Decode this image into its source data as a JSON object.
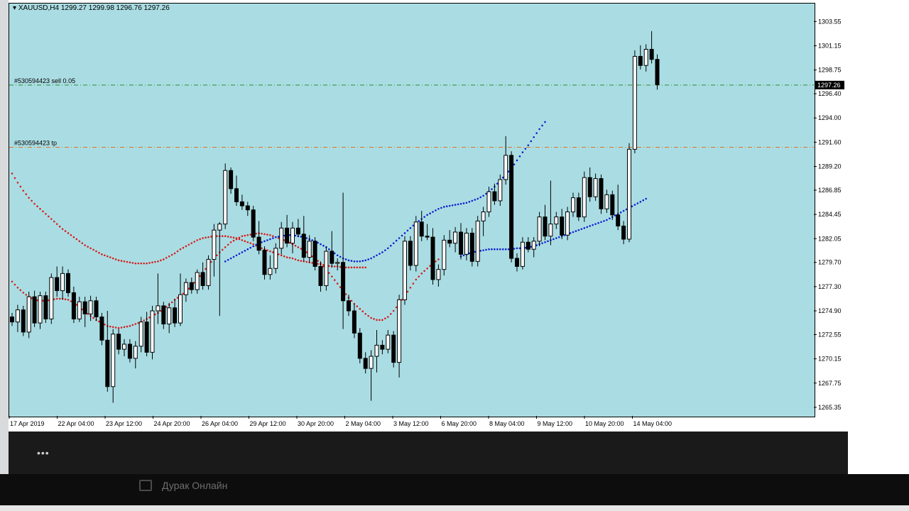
{
  "window": {
    "title": "XAUUSD,H4  1299.27 1299.98 1296.76 1297.26",
    "symbol": "XAUUSD",
    "timeframe": "H4"
  },
  "orders": [
    {
      "label": "#530594423 sell 0.05",
      "price": 1297.26,
      "color": "#2e8b2e"
    },
    {
      "label": "#530594423 tp",
      "price": 1291.1,
      "color": "#e07020"
    }
  ],
  "current_price_label": "1297.26",
  "taskbar": {
    "app_label": "Дурак Онлайн"
  },
  "colors": {
    "background": "#aadde3",
    "bull": "#ffffff",
    "bear": "#000000",
    "fast_ma": "#d42020",
    "slow_ma": "#1020d0"
  },
  "chart_data": {
    "type": "candlestick",
    "title": "XAUUSD,H4",
    "ylim": [
      1264.5,
      1305.4
    ],
    "y_ticks": [
      "1303.55",
      "1301.15",
      "1298.75",
      "1296.40",
      "1294.00",
      "1291.60",
      "1289.20",
      "1286.85",
      "1284.45",
      "1282.05",
      "1279.70",
      "1277.30",
      "1274.90",
      "1272.55",
      "1270.15",
      "1267.75",
      "1265.35"
    ],
    "x_ticks": [
      "17 Apr 2019",
      "22 Apr 04:00",
      "23 Apr 12:00",
      "24 Apr 20:00",
      "26 Apr 04:00",
      "29 Apr 12:00",
      "30 Apr 20:00",
      "2 May 04:00",
      "3 May 12:00",
      "6 May 20:00",
      "8 May 04:00",
      "9 May 12:00",
      "10 May 20:00",
      "14 May 04:00"
    ],
    "candles": [
      [
        1274.3,
        1274.7,
        1273.4,
        1273.8
      ],
      [
        1273.8,
        1275.5,
        1272.8,
        1275.0
      ],
      [
        1275.0,
        1275.4,
        1272.4,
        1272.8
      ],
      [
        1272.8,
        1276.8,
        1272.2,
        1276.3
      ],
      [
        1276.3,
        1276.9,
        1273.3,
        1273.7
      ],
      [
        1273.7,
        1276.8,
        1273.1,
        1276.4
      ],
      [
        1276.4,
        1276.8,
        1273.7,
        1274.1
      ],
      [
        1274.1,
        1278.6,
        1273.6,
        1278.2
      ],
      [
        1278.2,
        1279.3,
        1276.3,
        1276.9
      ],
      [
        1276.9,
        1279.3,
        1276.0,
        1278.6
      ],
      [
        1278.6,
        1279.0,
        1276.3,
        1276.7
      ],
      [
        1276.7,
        1277.3,
        1273.7,
        1274.1
      ],
      [
        1274.1,
        1276.3,
        1273.8,
        1275.8
      ],
      [
        1275.8,
        1276.3,
        1273.3,
        1274.6
      ],
      [
        1274.6,
        1276.4,
        1273.9,
        1275.9
      ],
      [
        1275.9,
        1276.3,
        1273.9,
        1274.3
      ],
      [
        1274.3,
        1274.7,
        1271.5,
        1272.0
      ],
      [
        1272.0,
        1274.9,
        1266.9,
        1267.4
      ],
      [
        1267.4,
        1273.1,
        1265.8,
        1272.6
      ],
      [
        1272.6,
        1273.1,
        1270.6,
        1271.1
      ],
      [
        1271.1,
        1272.1,
        1270.4,
        1271.6
      ],
      [
        1271.6,
        1272.1,
        1269.8,
        1270.2
      ],
      [
        1270.2,
        1271.9,
        1269.2,
        1271.4
      ],
      [
        1271.4,
        1274.3,
        1270.8,
        1273.8
      ],
      [
        1273.8,
        1274.8,
        1270.4,
        1270.8
      ],
      [
        1270.8,
        1275.4,
        1270.1,
        1274.9
      ],
      [
        1274.9,
        1278.6,
        1273.6,
        1275.4
      ],
      [
        1275.4,
        1275.8,
        1273.1,
        1273.6
      ],
      [
        1273.6,
        1275.7,
        1272.7,
        1275.2
      ],
      [
        1275.2,
        1276.1,
        1273.3,
        1273.7
      ],
      [
        1273.7,
        1278.6,
        1273.4,
        1276.5
      ],
      [
        1276.5,
        1278.1,
        1275.8,
        1277.7
      ],
      [
        1277.7,
        1278.2,
        1276.6,
        1277.0
      ],
      [
        1277.0,
        1279.0,
        1276.6,
        1278.7
      ],
      [
        1278.7,
        1279.7,
        1277.0,
        1277.4
      ],
      [
        1277.4,
        1280.4,
        1277.0,
        1280.0
      ],
      [
        1280.0,
        1283.5,
        1278.3,
        1282.9
      ],
      [
        1282.9,
        1283.7,
        1274.4,
        1283.5
      ],
      [
        1283.5,
        1289.5,
        1283.0,
        1288.8
      ],
      [
        1288.8,
        1289.1,
        1286.5,
        1287.0
      ],
      [
        1287.0,
        1288.3,
        1285.3,
        1285.7
      ],
      [
        1285.7,
        1286.4,
        1284.9,
        1285.3
      ],
      [
        1285.3,
        1285.7,
        1284.3,
        1284.9
      ],
      [
        1284.9,
        1285.3,
        1281.8,
        1282.2
      ],
      [
        1282.2,
        1283.8,
        1280.5,
        1280.9
      ],
      [
        1280.9,
        1281.3,
        1278.0,
        1278.5
      ],
      [
        1278.5,
        1280.4,
        1278.0,
        1279.1
      ],
      [
        1279.1,
        1281.6,
        1278.6,
        1281.1
      ],
      [
        1281.1,
        1283.7,
        1280.5,
        1283.1
      ],
      [
        1283.1,
        1284.4,
        1281.2,
        1281.6
      ],
      [
        1281.6,
        1283.7,
        1280.6,
        1283.1
      ],
      [
        1283.1,
        1284.0,
        1282.2,
        1282.5
      ],
      [
        1282.5,
        1284.3,
        1279.8,
        1280.2
      ],
      [
        1280.2,
        1282.4,
        1279.7,
        1281.8
      ],
      [
        1281.8,
        1282.2,
        1278.9,
        1279.3
      ],
      [
        1279.3,
        1279.8,
        1276.8,
        1277.4
      ],
      [
        1277.4,
        1281.3,
        1276.9,
        1280.8
      ],
      [
        1280.8,
        1282.8,
        1279.2,
        1279.6
      ],
      [
        1279.6,
        1280.1,
        1278.9,
        1279.7
      ],
      [
        1279.7,
        1286.6,
        1273.1,
        1275.9
      ],
      [
        1275.9,
        1276.5,
        1274.4,
        1274.9
      ],
      [
        1274.9,
        1275.6,
        1272.2,
        1272.7
      ],
      [
        1272.7,
        1273.2,
        1269.7,
        1270.2
      ],
      [
        1270.2,
        1270.8,
        1268.7,
        1269.2
      ],
      [
        1269.2,
        1271.0,
        1266.0,
        1270.4
      ],
      [
        1270.4,
        1273.0,
        1268.8,
        1271.5
      ],
      [
        1271.5,
        1272.0,
        1270.6,
        1271.1
      ],
      [
        1271.1,
        1273.0,
        1270.7,
        1272.5
      ],
      [
        1272.5,
        1272.9,
        1269.3,
        1269.8
      ],
      [
        1269.8,
        1276.5,
        1268.3,
        1276.0
      ],
      [
        1276.0,
        1282.3,
        1275.5,
        1281.8
      ],
      [
        1281.8,
        1282.3,
        1278.9,
        1279.4
      ],
      [
        1279.4,
        1284.3,
        1278.8,
        1283.7
      ],
      [
        1283.7,
        1284.8,
        1281.8,
        1282.3
      ],
      [
        1282.3,
        1283.5,
        1281.9,
        1282.2
      ],
      [
        1282.2,
        1283.1,
        1277.5,
        1278.0
      ],
      [
        1278.0,
        1279.5,
        1277.3,
        1279.0
      ],
      [
        1279.0,
        1282.4,
        1278.4,
        1281.9
      ],
      [
        1281.9,
        1282.9,
        1281.2,
        1281.6
      ],
      [
        1281.6,
        1283.2,
        1280.7,
        1282.7
      ],
      [
        1282.7,
        1283.6,
        1280.0,
        1280.5
      ],
      [
        1280.5,
        1283.1,
        1279.9,
        1282.6
      ],
      [
        1282.6,
        1283.1,
        1279.3,
        1279.8
      ],
      [
        1279.8,
        1284.3,
        1279.3,
        1283.8
      ],
      [
        1283.8,
        1285.2,
        1282.3,
        1284.7
      ],
      [
        1284.7,
        1287.2,
        1284.2,
        1286.7
      ],
      [
        1286.7,
        1287.5,
        1285.4,
        1285.8
      ],
      [
        1285.8,
        1288.4,
        1285.3,
        1287.9
      ],
      [
        1287.9,
        1292.2,
        1287.4,
        1290.3
      ],
      [
        1290.3,
        1290.7,
        1279.7,
        1280.1
      ],
      [
        1280.1,
        1280.6,
        1278.8,
        1279.3
      ],
      [
        1279.3,
        1282.2,
        1279.0,
        1281.7
      ],
      [
        1281.7,
        1282.2,
        1280.7,
        1281.0
      ],
      [
        1281.0,
        1282.2,
        1280.2,
        1281.8
      ],
      [
        1281.8,
        1284.7,
        1281.3,
        1284.2
      ],
      [
        1284.2,
        1285.4,
        1281.9,
        1282.3
      ],
      [
        1282.3,
        1287.8,
        1281.4,
        1283.5
      ],
      [
        1283.5,
        1284.7,
        1283.0,
        1284.2
      ],
      [
        1284.2,
        1285.0,
        1282.0,
        1282.4
      ],
      [
        1282.4,
        1285.2,
        1281.9,
        1284.7
      ],
      [
        1284.7,
        1286.6,
        1284.2,
        1286.1
      ],
      [
        1286.1,
        1286.6,
        1283.8,
        1284.2
      ],
      [
        1284.2,
        1288.7,
        1283.7,
        1288.1
      ],
      [
        1288.1,
        1289.1,
        1285.7,
        1286.2
      ],
      [
        1286.2,
        1288.5,
        1285.8,
        1288.0
      ],
      [
        1288.0,
        1288.4,
        1284.5,
        1285.0
      ],
      [
        1285.0,
        1286.9,
        1284.6,
        1286.4
      ],
      [
        1286.4,
        1286.8,
        1283.9,
        1284.4
      ],
      [
        1284.4,
        1287.4,
        1282.9,
        1283.3
      ],
      [
        1283.3,
        1283.8,
        1281.5,
        1282.0
      ],
      [
        1282.0,
        1291.5,
        1281.7,
        1290.9
      ],
      [
        1290.9,
        1300.7,
        1290.5,
        1300.1
      ],
      [
        1300.1,
        1301.2,
        1298.8,
        1299.2
      ],
      [
        1299.2,
        1301.3,
        1298.6,
        1300.8
      ],
      [
        1300.8,
        1302.6,
        1299.4,
        1299.8
      ],
      [
        1299.8,
        1300.3,
        1296.8,
        1297.3
      ]
    ],
    "indicators": [
      {
        "name": "",
        "color": "#d42020",
        "values": [
          1277.8,
          1277.2,
          1276.7,
          1276.3,
          1276.0,
          1275.9,
          1275.9,
          1276.0,
          1276.1,
          1276.1,
          1276.0,
          1275.7,
          1275.3,
          1274.8,
          1274.4,
          1274.0,
          1273.7,
          1273.4,
          1273.3,
          1273.2,
          1273.3,
          1273.4,
          1273.6,
          1273.8,
          1274.1,
          1274.4,
          1274.7,
          1275.1,
          1275.5,
          1276.0,
          1276.4,
          1276.8,
          1277.4,
          1278.0,
          1278.7,
          1279.4,
          1280.1,
          1280.7,
          1281.2,
          1281.7,
          1282.0,
          1282.3,
          1282.4,
          1282.5,
          1282.6,
          1282.5,
          1282.4,
          1282.2,
          1282.0,
          1281.8,
          1281.5,
          1281.2,
          1280.9,
          1280.5,
          1280.1,
          1279.6,
          1279.0,
          1278.3,
          1277.6,
          1276.9,
          1276.2,
          1275.6,
          1275.1,
          1274.6,
          1274.2,
          1274.0,
          1274.0,
          1274.3,
          1274.9,
          1275.6,
          1276.4,
          1277.2,
          1278.0,
          1278.6,
          1279.1,
          1279.6,
          1280.0
        ]
      },
      {
        "name": "",
        "color": "#d42020",
        "values": [
          1288.5,
          1287.6,
          1286.8,
          1286.1,
          1285.5,
          1285.0,
          1284.5,
          1284.0,
          1283.5,
          1283.0,
          1282.6,
          1282.2,
          1281.8,
          1281.4,
          1281.1,
          1280.8,
          1280.5,
          1280.3,
          1280.1,
          1279.9,
          1279.8,
          1279.7,
          1279.6,
          1279.6,
          1279.6,
          1279.7,
          1279.8,
          1280.0,
          1280.3,
          1280.6,
          1281.0,
          1281.3,
          1281.6,
          1281.9,
          1282.1,
          1282.2,
          1282.3,
          1282.3,
          1282.3,
          1282.2,
          1282.1,
          1281.9,
          1281.7,
          1281.5,
          1281.2,
          1281.0,
          1280.8,
          1280.6,
          1280.4,
          1280.2,
          1280.1,
          1279.9,
          1279.8,
          1279.7,
          1279.6,
          1279.5,
          1279.4,
          1279.3,
          1279.3,
          1279.2,
          1279.2,
          1279.2,
          1279.2,
          1279.2
        ]
      },
      {
        "name": "",
        "color": "#1020d0",
        "values": [
          1279.8,
          1280.1,
          1280.4,
          1280.7,
          1281.0,
          1281.3,
          1281.6,
          1281.8,
          1282.0,
          1282.2,
          1282.3,
          1282.4,
          1282.4,
          1282.3,
          1282.2,
          1282.0,
          1281.8,
          1281.5,
          1281.2,
          1280.8,
          1280.4,
          1280.1,
          1279.9,
          1279.8,
          1279.8,
          1279.9,
          1280.1,
          1280.4,
          1280.7,
          1281.1,
          1281.6,
          1282.1,
          1282.6,
          1283.1,
          1283.6,
          1284.0,
          1284.4,
          1284.7,
          1285.0,
          1285.2,
          1285.3,
          1285.4,
          1285.5,
          1285.6,
          1285.8,
          1286.0,
          1286.3,
          1286.7,
          1287.2,
          1287.8,
          1288.4,
          1289.0,
          1289.8,
          1290.6,
          1291.3,
          1292.1,
          1292.9,
          1293.6
        ]
      },
      {
        "name": "",
        "color": "#1020d0",
        "values": [
          1280.3,
          1280.5,
          1280.7,
          1280.8,
          1280.9,
          1281.0,
          1281.0,
          1281.0,
          1281.0,
          1281.0,
          1281.1,
          1281.1,
          1281.2,
          1281.3,
          1281.5,
          1281.7,
          1281.9,
          1282.1,
          1282.3,
          1282.5,
          1282.7,
          1282.9,
          1283.1,
          1283.3,
          1283.5,
          1283.7,
          1283.9,
          1284.2,
          1284.5,
          1284.8,
          1285.1,
          1285.4,
          1285.7,
          1286.0
        ]
      }
    ]
  }
}
